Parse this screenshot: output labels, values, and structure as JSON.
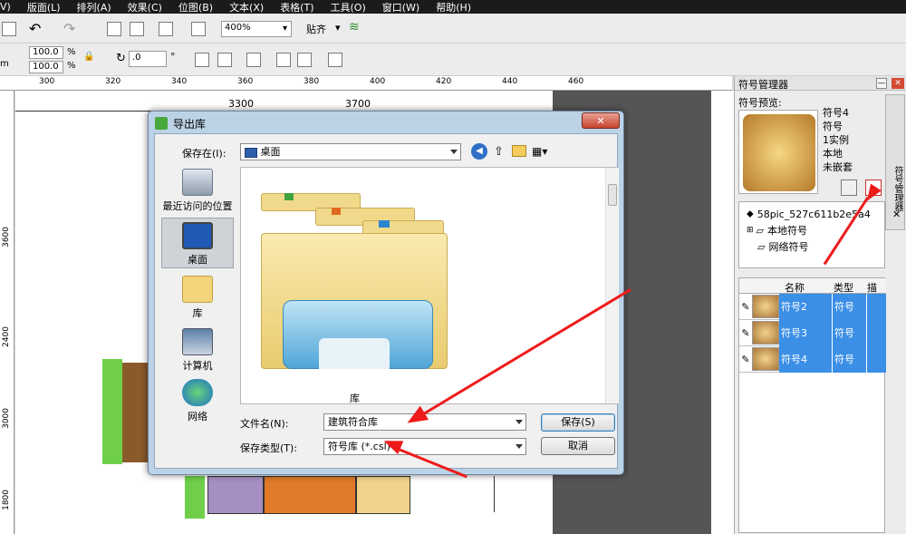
{
  "menu": [
    "V)",
    "版面(L)",
    "排列(A)",
    "效果(C)",
    "位图(B)",
    "文本(X)",
    "表格(T)",
    "工具(O)",
    "窗口(W)",
    "帮助(H)"
  ],
  "toolbar": {
    "zoom": "400%",
    "snap": "贴齐"
  },
  "props": {
    "left_unit": "m",
    "scale_w": "100.0",
    "scale_h": "100.0",
    "pct1": "%",
    "pct2": "%",
    "rotate": ".0",
    "degree": "°"
  },
  "ruler_h": [
    "300",
    "320",
    "340",
    "360",
    "380",
    "400",
    "420",
    "440",
    "460"
  ],
  "ruler_v": [
    "3600",
    "2400",
    "3000",
    "1800"
  ],
  "canvas": {
    "dim1": "3300",
    "dim2": "3700"
  },
  "dialog": {
    "title": "导出库",
    "save_in_label": "保存在(I):",
    "save_in_value": "桌面",
    "places": [
      {
        "label": "最近访问的位置",
        "icon": "recent-places-icon"
      },
      {
        "label": "桌面",
        "icon": "desktop-icon"
      },
      {
        "label": "库",
        "icon": "libraries-icon"
      },
      {
        "label": "计算机",
        "icon": "computer-icon"
      },
      {
        "label": "网络",
        "icon": "network-icon"
      }
    ],
    "file_item": "库",
    "filename_label": "文件名(N):",
    "filename_value": "建筑符合库",
    "filetype_label": "保存类型(T):",
    "filetype_value": "符号库 (*.csl)",
    "save_btn": "保存(S)",
    "cancel_btn": "取消"
  },
  "docker": {
    "title": "符号管理器",
    "preview_label": "符号预览:",
    "info": [
      "符号4",
      "符号",
      "1实例",
      "本地",
      "未嵌套"
    ],
    "tree": [
      "58pic_527c611b2e5a4",
      "本地符号",
      "网络符号"
    ],
    "cols": [
      "名称",
      "类型",
      "描"
    ],
    "rows": [
      {
        "name": "符号2",
        "type": "符号"
      },
      {
        "name": "符号3",
        "type": "符号"
      },
      {
        "name": "符号4",
        "type": "符号"
      }
    ],
    "side_tab": "符号管理器"
  },
  "colors": {
    "accent": "#3b8fe6",
    "arrow": "#ee1b1b"
  }
}
